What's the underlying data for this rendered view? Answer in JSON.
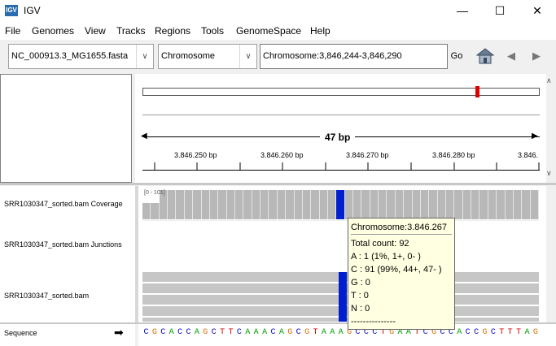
{
  "window": {
    "title": "IGV",
    "minimize": "—",
    "maximize": "☐",
    "close": "✕"
  },
  "menu": [
    "File",
    "Genomes",
    "View",
    "Tracks",
    "Regions",
    "Tools",
    "GenomeSpace",
    "Help"
  ],
  "toolbar": {
    "genome": "NC_000913.3_MG1655.fasta",
    "chromosome": "Chromosome",
    "locus": "Chromosome:3,846,244-3,846,290",
    "go": "Go"
  },
  "ruler": {
    "span": "47 bp",
    "ticks": [
      "3.846.250 bp",
      "3.846.260 bp",
      "3.846.270 bp",
      "3.846.280 bp",
      "3.846."
    ]
  },
  "tracks": {
    "coverage_label": "SRR1030347_sorted.bam Coverage",
    "coverage_range": "[0 - 101]",
    "junction_label": "SRR1030347_sorted.bam Junctions",
    "alignment_label": "SRR1030347_sorted.bam"
  },
  "tooltip": {
    "title": "Chromosome:3.846.267",
    "total": "Total count: 92",
    "a": "A : 1 (1%, 1+, 0- )",
    "c": "C : 91 (99%, 44+, 47- )",
    "g": "G : 0",
    "t": "T : 0",
    "n": "N : 0",
    "sep": "---------------"
  },
  "sequence": {
    "label": "Sequence",
    "arrow": "➡",
    "bases": "CGCACCAGCTTCAAACAGCGTAAAGCCCTGAATCGCCACCGCTTTAG"
  },
  "colors": {
    "A": "#00a000",
    "C": "#0000c8",
    "G": "#d17105",
    "T": "#d00000",
    "highlight": "#0020d0",
    "marker": "#e00000"
  }
}
